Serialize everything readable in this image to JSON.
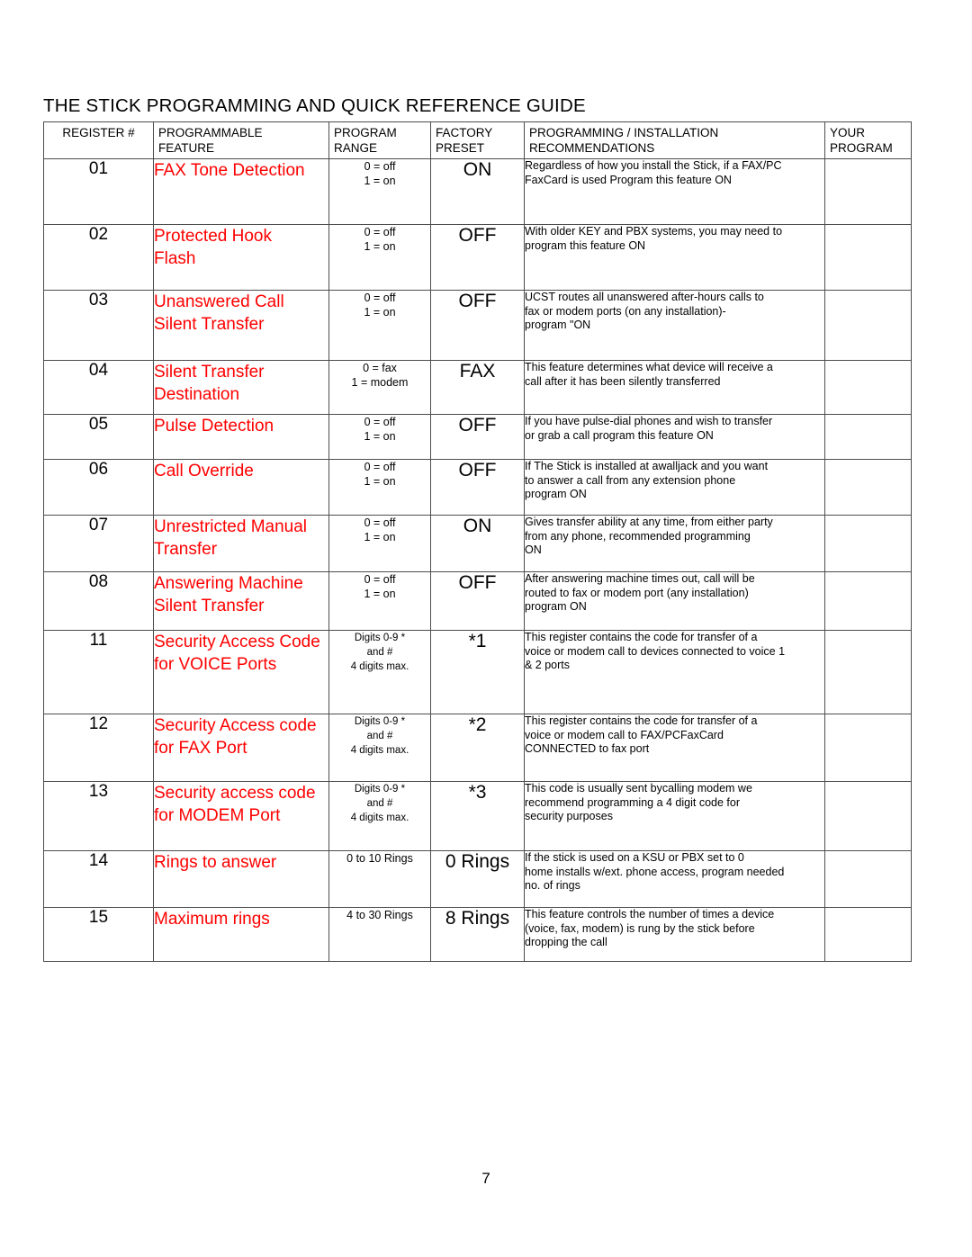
{
  "document": {
    "title": "THE STICK PROGRAMMING AND QUICK REFERENCE GUIDE",
    "page_number": "7",
    "accent_color": "#ff0000"
  },
  "table": {
    "headers": {
      "register": "REGISTER #",
      "feature_1": "PROGRAMMABLE",
      "feature_2": "FEATURE",
      "range_1": "PROGRAM",
      "range_2": "RANGE",
      "preset_1": "FACTORY",
      "preset_2": "PRESET",
      "rec_1": "PROGRAMMING / INSTALLATION",
      "rec_2": "RECOMMENDATIONS",
      "your_1": "YOUR",
      "your_2": "PROGRAM"
    },
    "rows": [
      {
        "register": "01",
        "feature": [
          "FAX Tone Detection"
        ],
        "range": [
          "0 = off",
          "1 = on"
        ],
        "preset": "ON",
        "recommendation": [
          "Regardless of how you install the Stick, if a FAX/PC",
          "FaxCard is used Program this feature  ON"
        ],
        "your_program": ""
      },
      {
        "register": "02",
        "feature": [
          "Protected Hook",
          "Flash"
        ],
        "range": [
          "0 = off",
          "1 = on"
        ],
        "preset": "OFF",
        "recommendation": [
          "With older KEY and PBX systems, you may need to",
          "program this feature  ON"
        ],
        "your_program": ""
      },
      {
        "register": "03",
        "feature": [
          "Unanswered Call",
          "Silent Transfer"
        ],
        "range": [
          "0 = off",
          "1 = on"
        ],
        "preset": "OFF",
        "recommendation": [
          " UCST  routes all unanswered after-hours calls to",
          "fax or modem ports (on any installation)-",
          "program \"ON"
        ],
        "your_program": ""
      },
      {
        "register": "04",
        "feature": [
          "Silent Transfer",
          "Destination"
        ],
        "range": [
          "0 = fax",
          "1 = modem"
        ],
        "preset": "FAX",
        "recommendation": [
          "This feature determines what device will receive a",
          "call after it has been  silently transferred"
        ],
        "your_program": ""
      },
      {
        "register": "05",
        "feature": [
          "Pulse Detection"
        ],
        "range": [
          "0 = off",
          "1 = on"
        ],
        "preset": "OFF",
        "recommendation": [
          "If you have pulse-dial phones and wish to transfer",
          "or  grab  a call program this feature  ON"
        ],
        "your_program": ""
      },
      {
        "register": "06",
        "feature": [
          "Call Override"
        ],
        "range": [
          "0 = off",
          "1 = on"
        ],
        "preset": "OFF",
        "recommendation": [
          "If The Stick is installed at awalljack and you want",
          "to answer a call from any extension phone",
          "program  ON"
        ],
        "your_program": ""
      },
      {
        "register": "07",
        "feature": [
          "Unrestricted Manual",
          "Transfer"
        ],
        "range": [
          "0 = off",
          "1 = on"
        ],
        "preset": "ON",
        "recommendation": [
          "Gives transfer ability at any time, from either party",
          "from any phone, recommended programming",
          " ON"
        ],
        "your_program": ""
      },
      {
        "register": "08",
        "feature": [
          "Answering Machine",
          "Silent Transfer"
        ],
        "range": [
          "0 = off",
          "1 = on"
        ],
        "preset": "OFF",
        "recommendation": [
          "After answering machine times out, call will be",
          "routed to fax or modem port (any installation)",
          "program  ON"
        ],
        "your_program": ""
      },
      {
        "register": "11",
        "feature": [
          "Security Access Code",
          "for VOICE Ports"
        ],
        "range": [
          "Digits 0-9 *",
          "and #",
          "4 digits max."
        ],
        "preset": "*1",
        "recommendation": [
          "This register contains the code for transfer of a",
          "voice or modem call to devices connected to voice 1",
          "& 2 ports"
        ],
        "your_program": ""
      },
      {
        "register": "12",
        "feature": [
          "Security Access code",
          "for FAX Port"
        ],
        "range": [
          "Digits 0-9 *",
          "and #",
          "4 digits max."
        ],
        "preset": "*2",
        "recommendation": [
          "This register contains the code for transfer of a",
          "voice or modem call to FAX/PCFaxCard",
          "CONNECTED to fax port"
        ],
        "your_program": ""
      },
      {
        "register": "13",
        "feature": [
          "Security access code",
          "for MODEM Port"
        ],
        "range": [
          "Digits 0-9 *",
          "and #",
          "4 digits max."
        ],
        "preset": "*3",
        "recommendation": [
          "This code is usually sent bycalling modem we",
          "recommend programming a 4 digit code for",
          "security purposes"
        ],
        "your_program": ""
      },
      {
        "register": "14",
        "feature": [
          "Rings to answer"
        ],
        "range": [
          "0 to 10 Rings"
        ],
        "preset": "0 Rings",
        "recommendation": [
          "If the stick is used on a KSU or PBX set to  0",
          "home installs w/ext. phone access, program needed",
          "no. of rings"
        ],
        "your_program": ""
      },
      {
        "register": "15",
        "feature": [
          "Maximum rings"
        ],
        "range": [
          "4 to 30 Rings"
        ],
        "preset": "8 Rings",
        "recommendation": [
          "This feature controls the number of times a device",
          "(voice, fax, modem) is rung by the stick before",
          "dropping the call"
        ],
        "your_program": ""
      }
    ]
  }
}
